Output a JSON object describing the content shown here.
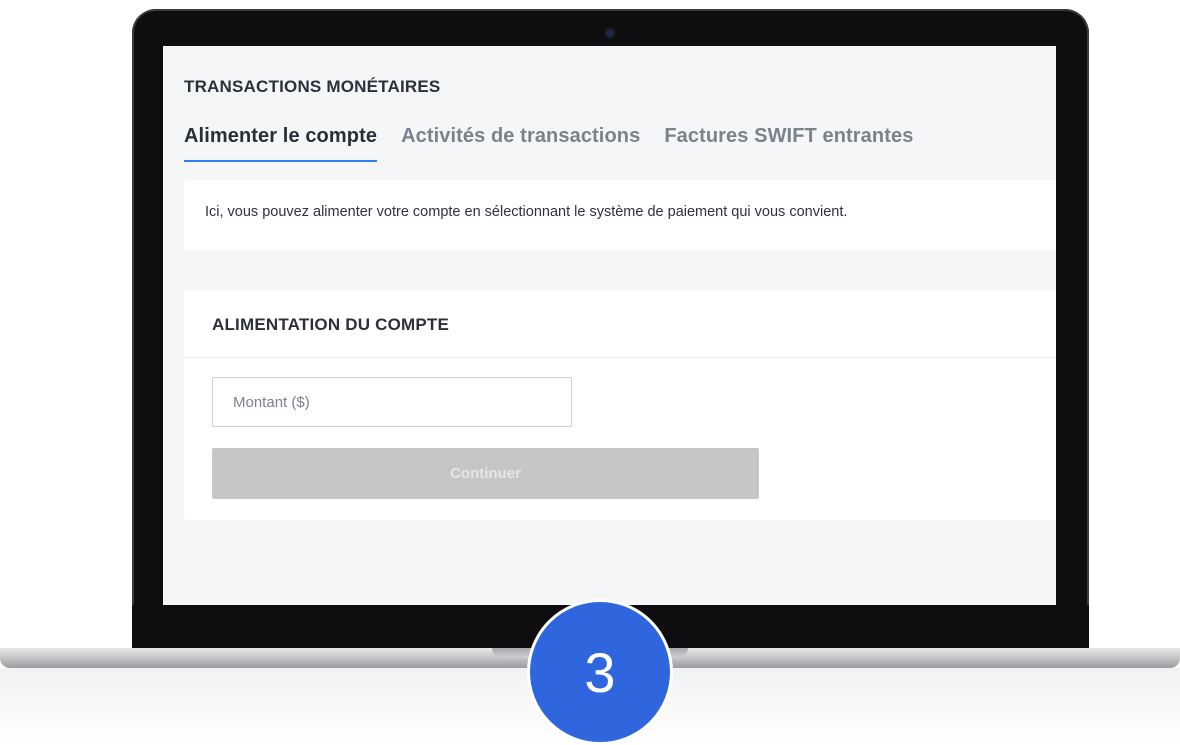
{
  "page": {
    "title": "TRANSACTIONS MONÉTAIRES"
  },
  "tabs": [
    {
      "label": "Alimenter le compte",
      "active": true
    },
    {
      "label": "Activités de transactions",
      "active": false
    },
    {
      "label": "Factures SWIFT entrantes",
      "active": false
    }
  ],
  "info": {
    "text": "Ici, vous pouvez alimenter votre compte en sélectionnant le système de paiement qui vous convient."
  },
  "funding_form": {
    "title": "ALIMENTATION DU COMPTE",
    "amount_placeholder": "Montant ($)",
    "amount_value": "",
    "continue_label": "Continuer"
  },
  "step_badge": {
    "number": "3"
  },
  "colors": {
    "accent": "#2f80ed",
    "badge": "#2f66de",
    "disabled_button": "#c6c6c6"
  }
}
